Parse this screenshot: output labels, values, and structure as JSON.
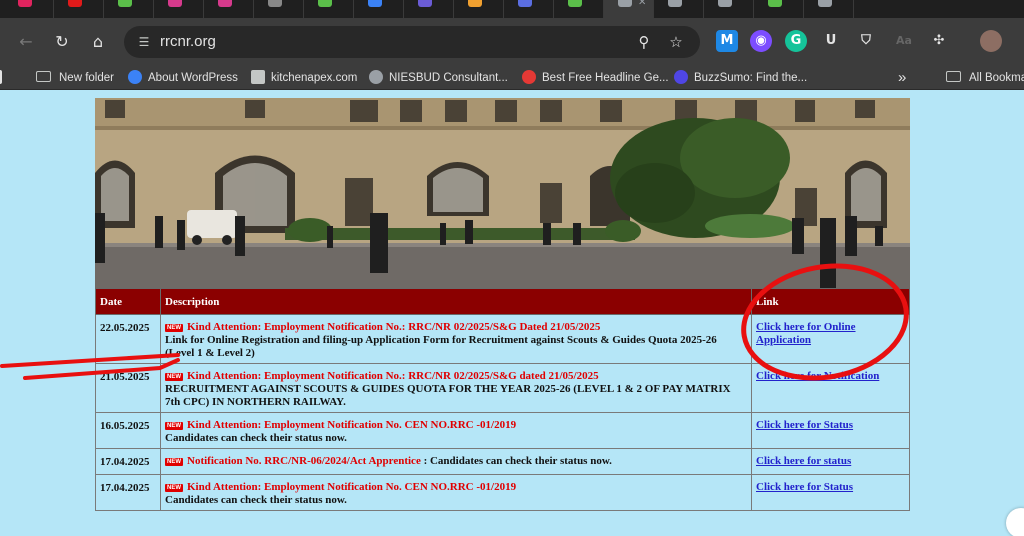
{
  "browser": {
    "url": "rrcnr.org",
    "tabs": [
      {
        "color": "#e0245e"
      },
      {
        "color": "#e01a1a"
      },
      {
        "color": "#5bbf4a"
      },
      {
        "color": "#d63a8c"
      },
      {
        "color": "#d63a8c"
      },
      {
        "color": "#888888"
      },
      {
        "color": "#5bbf4a"
      },
      {
        "color": "#3b82f6"
      },
      {
        "color": "#6b5cd6"
      },
      {
        "color": "#f0a030"
      },
      {
        "color": "#5b6ee1"
      },
      {
        "color": "#5bbf4a"
      },
      {
        "color": "#9aa0a6",
        "active": true
      },
      {
        "color": "#9aa0a6"
      },
      {
        "color": "#9aa0a6"
      },
      {
        "color": "#5bbf4a"
      },
      {
        "color": "#9aa0a6"
      }
    ],
    "bookmarks": [
      {
        "label": "New folder",
        "icon": "folder-icon"
      },
      {
        "label": "About WordPress",
        "icon": "wordpress-icon"
      },
      {
        "label": "kitchenapex.com",
        "icon": "kitchenapex-icon"
      },
      {
        "label": "NIESBUD Consultant...",
        "icon": "globe-icon"
      },
      {
        "label": "Best Free Headline Ge...",
        "icon": "headline-icon"
      },
      {
        "label": "BuzzSumo: Find the...",
        "icon": "buzzsumo-icon"
      }
    ],
    "overflow_label": "»",
    "all_bookmarks": "All Bookmarks"
  },
  "table": {
    "headers": {
      "date": "Date",
      "description": "Description",
      "link": "Link"
    },
    "new_badge": "NEW",
    "rows": [
      {
        "date": "22.05.2025",
        "title": "Kind Attention: Employment Notification No.: RRC/NR 02/2025/S&G Dated 21/05/2025",
        "body": "Link for Online Registration and filing-up Application Form for Recruitment against Scouts & Guides Quota 2025-26 (Level 1 & Level 2)",
        "link": "Click here for Online Application"
      },
      {
        "date": "21.05.2025",
        "title": "Kind Attention: Employment Notification No.: RRC/NR 02/2025/S&G dated 21/05/2025",
        "body": "RECRUITMENT AGAINST SCOUTS & GUIDES QUOTA FOR THE YEAR 2025-26 (LEVEL 1 & 2 OF PAY MATRIX 7th CPC) IN NORTHERN RAILWAY.",
        "link": "Click here for Notification"
      },
      {
        "date": "16.05.2025",
        "title": "Kind Attention: Employment Notification No. CEN NO.RRC -01/2019",
        "body": "Candidates can check their status now.",
        "link": "Click here for Status"
      },
      {
        "date": "17.04.2025",
        "title": "Notification No. RRC/NR-06/2024/Act Apprentice",
        "inline_body": ": Candidates can check their status now.",
        "link": "Click here for status"
      },
      {
        "date": "17.04.2025",
        "title": "Kind Attention: Employment Notification No. CEN NO.RRC -01/2019",
        "body": "Candidates can check their status now.",
        "link": "Click here for Status"
      }
    ]
  }
}
